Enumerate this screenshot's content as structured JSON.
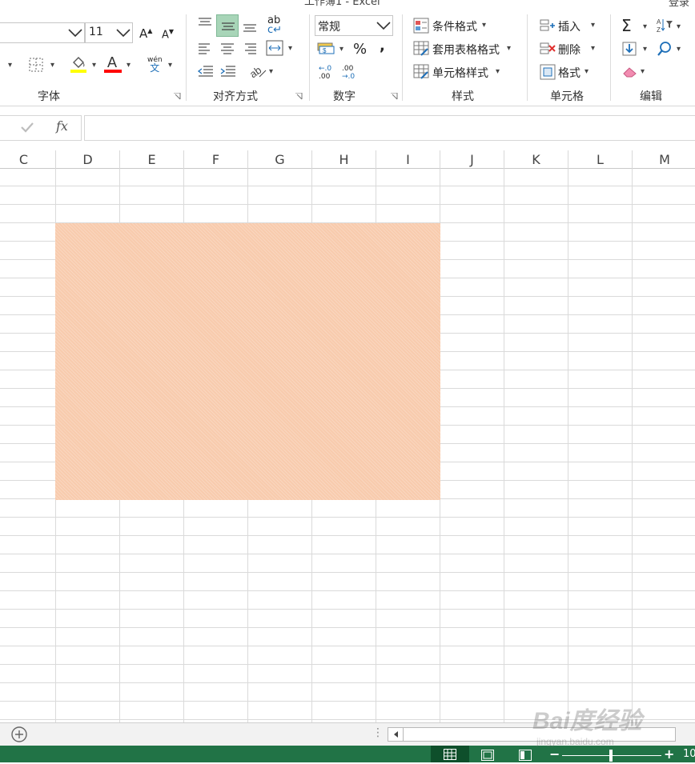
{
  "title_partial": "工作簿1 - Excel",
  "title_right_partial": "登录",
  "font": {
    "size": "11",
    "grow_label": "A",
    "shrink_label": "A",
    "phonetic_top": "wén",
    "phonetic_bottom": "文"
  },
  "groups": {
    "font": "字体",
    "alignment": "对齐方式",
    "number": "数字",
    "styles": "样式",
    "cells": "单元格",
    "editing": "编辑"
  },
  "number": {
    "format": "常规",
    "percent": "%",
    "comma": ",",
    "inc_top": "←.0",
    "inc_bottom": ".00",
    "dec_top": ".00",
    "dec_bottom": "→.0"
  },
  "styles": {
    "conditional": "条件格式",
    "table": "套用表格格式",
    "cell": "单元格样式"
  },
  "cells": {
    "insert": "插入",
    "delete": "删除",
    "format": "格式"
  },
  "wrap_text": {
    "top": "ab",
    "bottom": "c↵"
  },
  "formula_bar": {
    "fx": "fx",
    "value": ""
  },
  "columns": [
    "C",
    "D",
    "E",
    "F",
    "G",
    "H",
    "I",
    "J",
    "K",
    "L",
    "M"
  ],
  "highlight": {
    "color": "#f8cbad",
    "range": "D4:I18"
  },
  "zoom": {
    "label_partial": "10"
  },
  "colors": {
    "status_bar": "#217346",
    "accent_selected": "#a8d5b8",
    "fill_bar": "#ffff00",
    "font_bar": "#ff0000"
  },
  "watermark": {
    "brand": "Bai度经验",
    "url": "jingyan.baidu.com"
  }
}
